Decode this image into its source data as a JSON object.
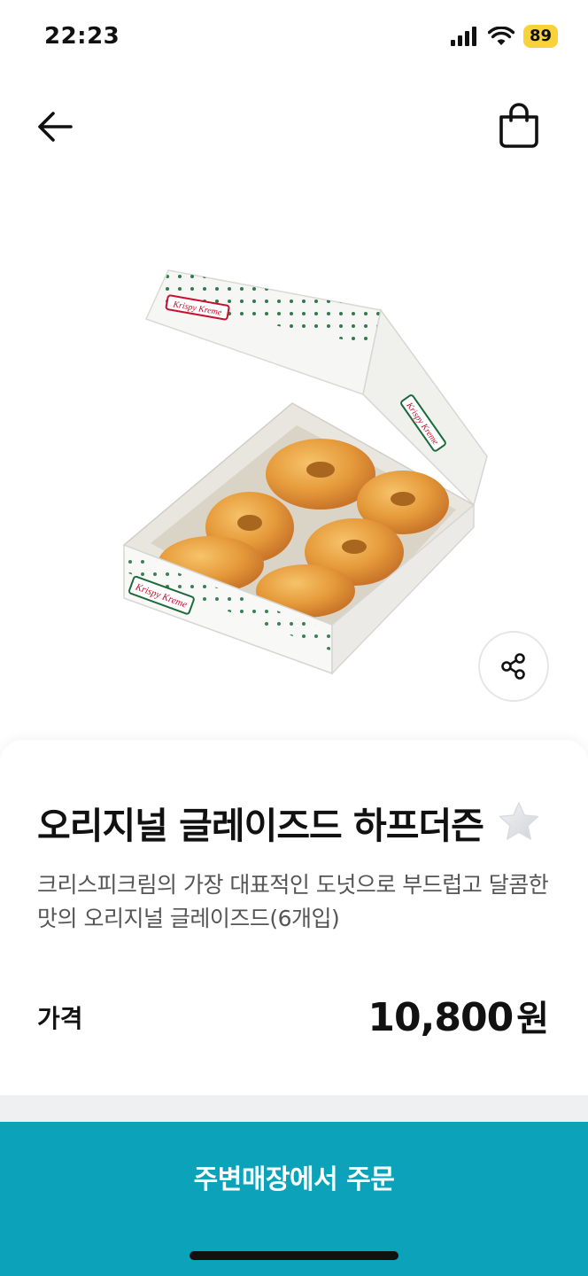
{
  "status_bar": {
    "time": "22:23",
    "battery": "89",
    "icons": [
      "cellular-signal-icon",
      "wifi-icon",
      "battery-icon"
    ]
  },
  "nav": {
    "back_icon": "arrow-left-icon",
    "cart_icon": "shopping-bag-icon"
  },
  "product": {
    "image_icon": "donut-box-image",
    "title": "오리지널 글레이즈드 하프더즌",
    "description": "크리스피크림의 가장 대표적인 도넛으로 부드럽고 달콤한 맛의 오리지널 글레이즈드(6개입)",
    "price_label": "가격",
    "price": "10,800",
    "price_unit": "원",
    "favorite_icon": "star-icon",
    "share_icon": "share-icon"
  },
  "order_button": {
    "label": "주변매장에서 주문"
  },
  "colors": {
    "accent": "#0ca3ba",
    "battery_badge": "#f7d23a",
    "brand_green": "#1b6b3a",
    "brand_red": "#c8102e"
  }
}
